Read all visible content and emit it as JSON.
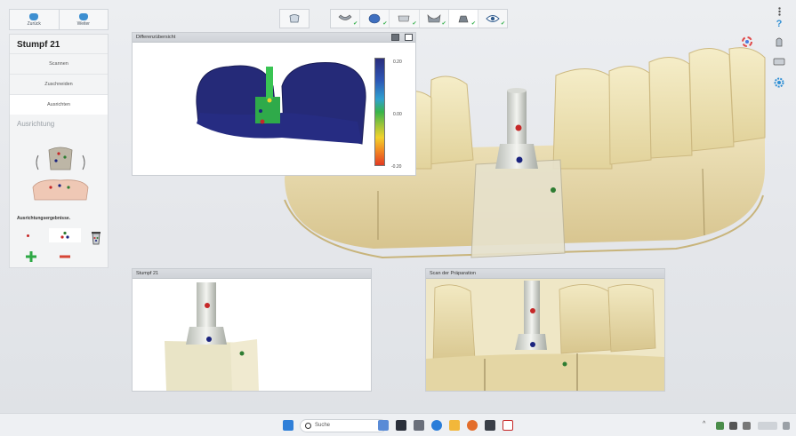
{
  "nav": {
    "back_label": "Zurück",
    "forward_label": "Weiter"
  },
  "left_panel": {
    "title": "Stumpf 21",
    "steps": [
      "Scannen",
      "Zuschneiden",
      "Ausrichten"
    ],
    "active_step": 2,
    "section_label": "Ausrichtung",
    "results_label": "Ausrichtungsergebnisse."
  },
  "toolbar": {
    "icons": [
      "lower-jaw-icon",
      "abutment-scan-icon",
      "upper-jaw-icon",
      "bite-icon",
      "stump-icon",
      "eye-icon"
    ],
    "selected": 4
  },
  "windows": {
    "diff": {
      "title": "Differenzübersicht",
      "legend": {
        "max": "0.20",
        "mid": "0.00",
        "min": "-0.20"
      }
    },
    "stumpf": {
      "title": "Stumpf 21"
    },
    "scan": {
      "title": "Scan der Präparation"
    }
  },
  "taskbar": {
    "search_placeholder": "Suche"
  },
  "colors": {
    "accent": "#3d8fd1",
    "check": "#36b04c",
    "add": "#2ea845",
    "remove": "#d64535"
  }
}
